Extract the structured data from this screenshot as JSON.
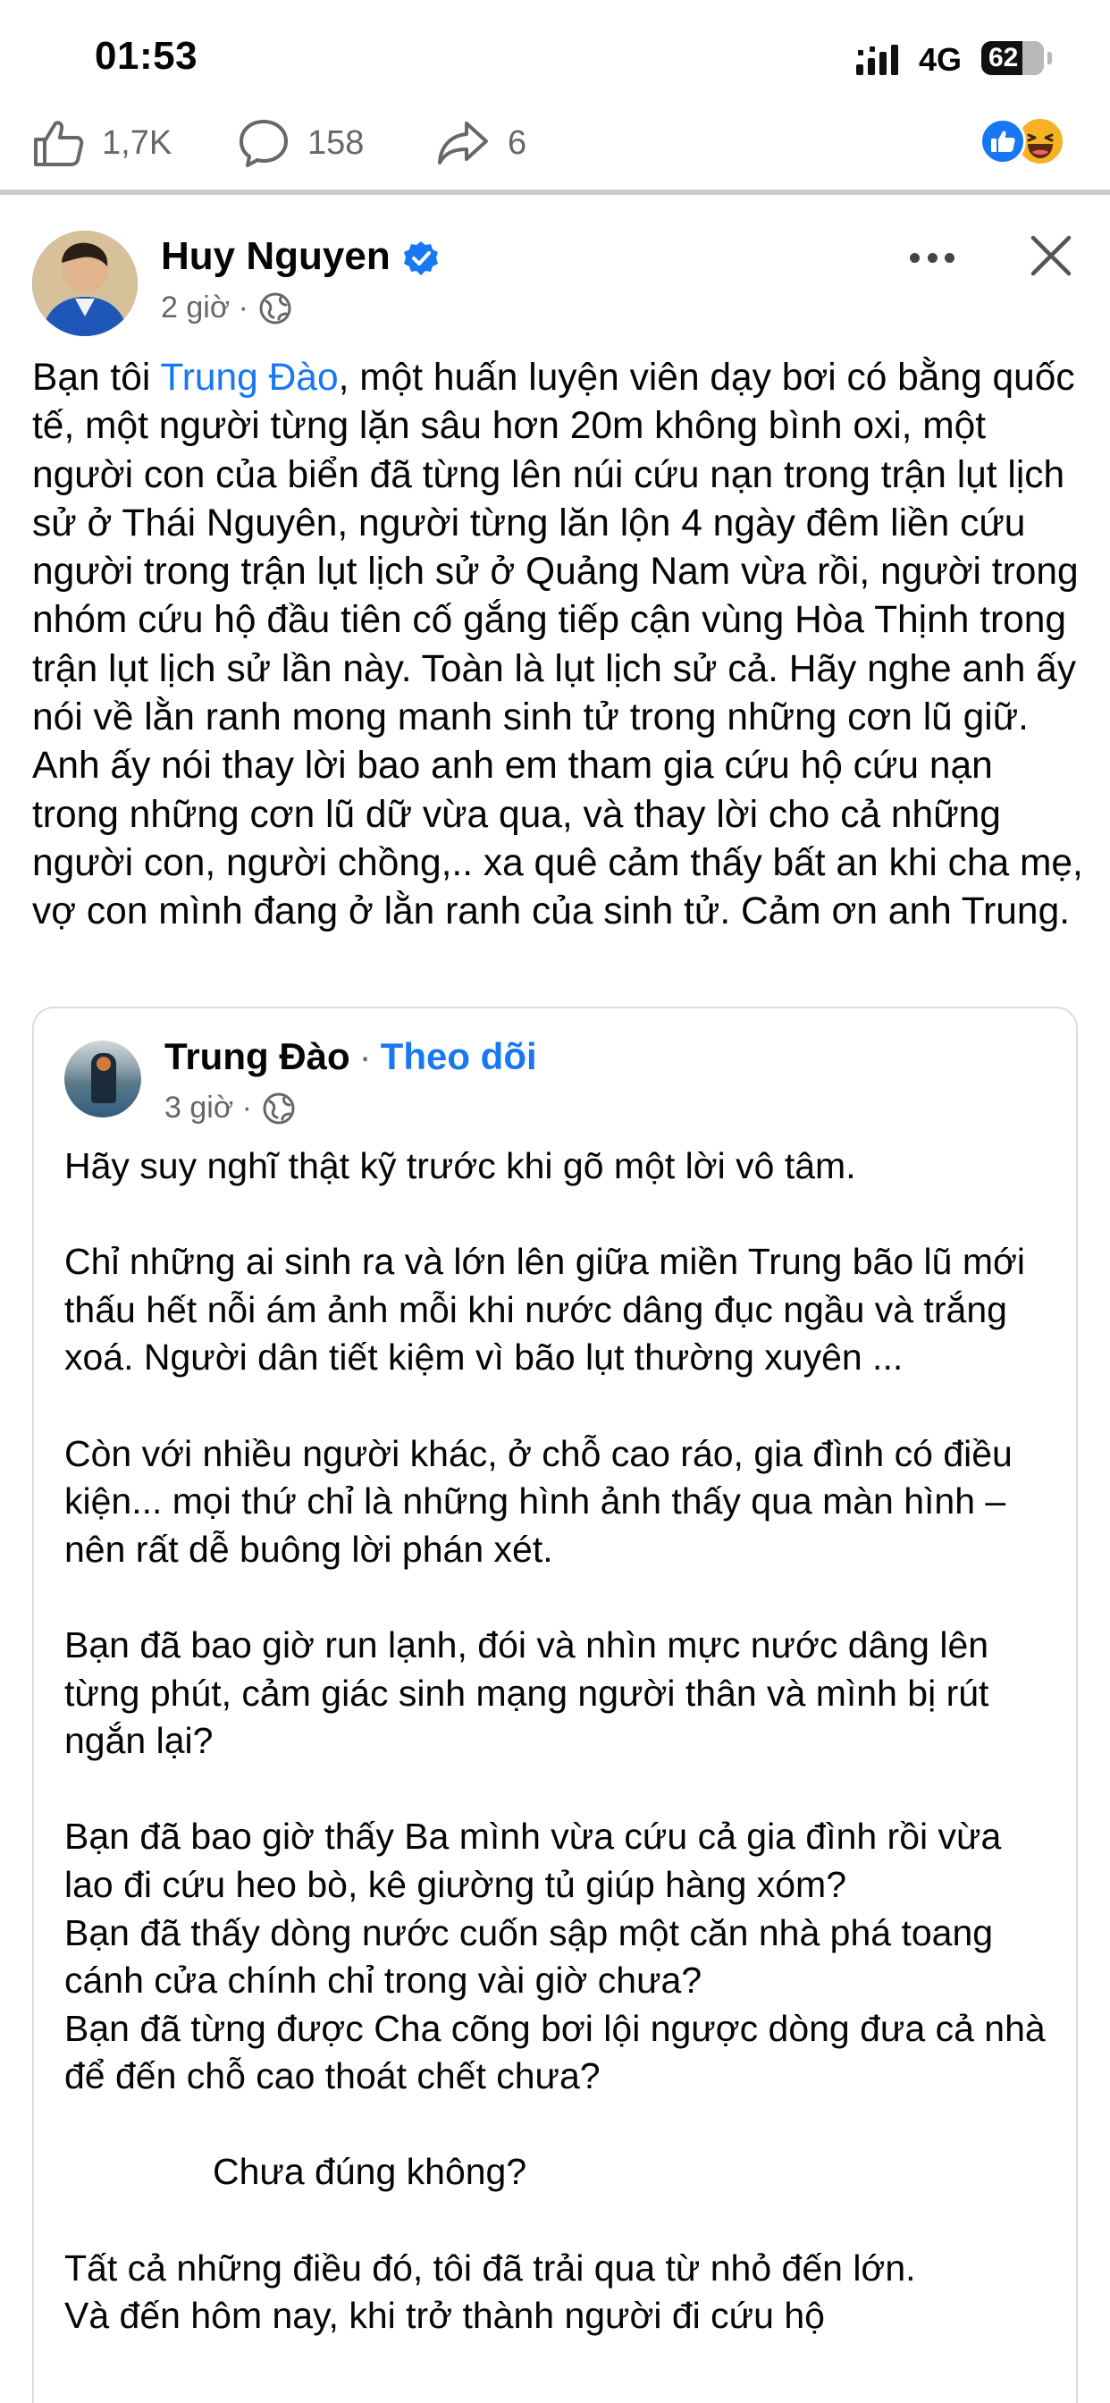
{
  "status_bar": {
    "time": "01:53",
    "network": "4G",
    "battery": "62"
  },
  "reactions": {
    "likes": "1,7K",
    "comments": "158",
    "shares": "6",
    "icons": [
      "like-reaction-icon",
      "haha-reaction-icon"
    ],
    "like_color": "#1877f2",
    "haha_color": "#f7b125"
  },
  "post": {
    "author": "Huy Nguyen",
    "time": "2 giờ",
    "text_before_mention": "Bạn tôi ",
    "mention": "Trung Đào",
    "text_after_mention": ", một huấn luyện viên dạy bơi có bằng quốc tế, một người từng lặn sâu hơn 20m không bình oxi, một người con của biển đã từng lên núi cứu nạn trong trận lụt lịch sử ở Thái Nguyên, người từng lăn lộn 4 ngày đêm liền cứu người trong trận lụt lịch sử ở Quảng Nam vừa rồi, người trong nhóm cứu hộ đầu tiên cố gắng tiếp cận vùng Hòa Thịnh trong trận lụt lịch sử lần này. Toàn là lụt lịch sử cả. Hãy nghe anh ấy nói về lằn ranh mong manh sinh tử trong những cơn lũ giữ. Anh ấy nói thay lời bao anh em tham gia cứu hộ cứu nạn trong những cơn lũ dữ vừa qua, và thay lời cho cả những người con, người chồng,.. xa quê cảm thấy bất an khi cha mẹ, vợ con mình đang ở lằn ranh của sinh tử. Cảm ơn anh Trung."
  },
  "shared": {
    "author": "Trung Đào",
    "separator": "·",
    "follow": "Theo dõi",
    "time": "3 giờ",
    "p1": "Hãy suy nghĩ thật kỹ trước khi gõ một lời vô tâm.",
    "p2": "Chỉ những ai sinh ra và lớn lên giữa miền Trung bão lũ mới thấu hết nỗi ám ảnh mỗi khi nước dâng đục ngầu và trắng xoá. Người dân tiết kiệm vì bão lụt thường xuyên ...",
    "p3": "Còn với nhiều người khác, ở chỗ cao ráo, gia đình có điều kiện... mọi thứ chỉ là những hình ảnh thấy qua màn hình – nên rất dễ buông lời phán xét.",
    "p4": "Bạn đã bao giờ run lạnh, đói và nhìn mực nước dâng lên từng phút, cảm giác sinh mạng người thân và mình bị rút ngắn lại?",
    "p5a": "Bạn đã bao giờ thấy Ba mình vừa cứu cả gia đình rồi vừa lao đi cứu heo bò, kê giường tủ giúp hàng xóm?",
    "p5b": "Bạn đã thấy dòng nước cuốn sập một căn nhà phá toang cánh cửa chính chỉ trong vài giờ chưa?",
    "p5c": "Bạn đã từng được Cha cõng bơi lội ngược dòng đưa cả nhà để đến chỗ cao thoát chết chưa?",
    "p6": "Chưa đúng không?",
    "p7a": "Tất cả những điều đó, tôi đã trải qua từ nhỏ đến lớn.",
    "p7b": "Và đến hôm nay, khi trở thành người đi cứu hộ"
  }
}
